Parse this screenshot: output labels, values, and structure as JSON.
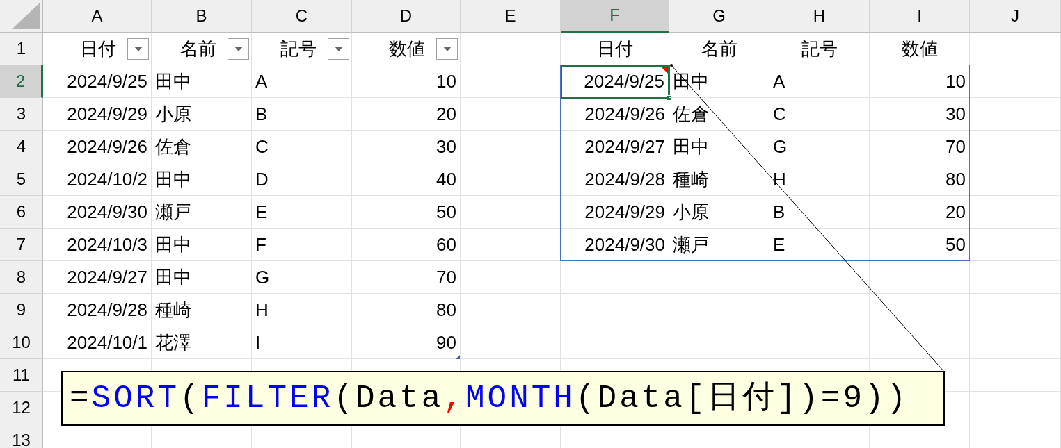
{
  "column_headers": [
    {
      "label": "A",
      "selected": false
    },
    {
      "label": "B",
      "selected": false
    },
    {
      "label": "C",
      "selected": false
    },
    {
      "label": "D",
      "selected": false
    },
    {
      "label": "E",
      "selected": false
    },
    {
      "label": "F",
      "selected": true
    },
    {
      "label": "G",
      "selected": false
    },
    {
      "label": "H",
      "selected": false
    },
    {
      "label": "I",
      "selected": false
    },
    {
      "label": "J",
      "selected": false
    }
  ],
  "row_headers": [
    {
      "label": "1",
      "selected": false
    },
    {
      "label": "2",
      "selected": true
    },
    {
      "label": "3",
      "selected": false
    },
    {
      "label": "4",
      "selected": false
    },
    {
      "label": "5",
      "selected": false
    },
    {
      "label": "6",
      "selected": false
    },
    {
      "label": "7",
      "selected": false
    },
    {
      "label": "8",
      "selected": false
    },
    {
      "label": "9",
      "selected": false
    },
    {
      "label": "10",
      "selected": false
    },
    {
      "label": "11",
      "selected": false
    },
    {
      "label": "12",
      "selected": false
    },
    {
      "label": "13",
      "selected": false
    }
  ],
  "source_table": {
    "columns": [
      {
        "label": "日付",
        "filter": true
      },
      {
        "label": "名前",
        "filter": true
      },
      {
        "label": "記号",
        "filter": true
      },
      {
        "label": "数値",
        "filter": true
      }
    ],
    "rows": [
      [
        "2024/9/25",
        "田中",
        "A",
        "10"
      ],
      [
        "2024/9/29",
        "小原",
        "B",
        "20"
      ],
      [
        "2024/9/26",
        "佐倉",
        "C",
        "30"
      ],
      [
        "2024/10/2",
        "田中",
        "D",
        "40"
      ],
      [
        "2024/9/30",
        "瀬戸",
        "E",
        "50"
      ],
      [
        "2024/10/3",
        "田中",
        "F",
        "60"
      ],
      [
        "2024/9/27",
        "田中",
        "G",
        "70"
      ],
      [
        "2024/9/28",
        "種崎",
        "H",
        "80"
      ],
      [
        "2024/10/1",
        "花澤",
        "I",
        "90"
      ]
    ]
  },
  "result_table": {
    "columns": [
      {
        "label": "日付"
      },
      {
        "label": "名前"
      },
      {
        "label": "記号"
      },
      {
        "label": "数値"
      }
    ],
    "rows": [
      [
        "2024/9/25",
        "田中",
        "A",
        "10"
      ],
      [
        "2024/9/26",
        "佐倉",
        "C",
        "30"
      ],
      [
        "2024/9/27",
        "田中",
        "G",
        "70"
      ],
      [
        "2024/9/28",
        "種崎",
        "H",
        "80"
      ],
      [
        "2024/9/29",
        "小原",
        "B",
        "20"
      ],
      [
        "2024/9/30",
        "瀬戸",
        "E",
        "50"
      ]
    ]
  },
  "formula_callout": {
    "segments": [
      {
        "text": "=",
        "kind": "plain"
      },
      {
        "text": "SORT",
        "kind": "function"
      },
      {
        "text": "(",
        "kind": "plain"
      },
      {
        "text": "FILTER",
        "kind": "function"
      },
      {
        "text": "(Data",
        "kind": "plain"
      },
      {
        "text": ",",
        "kind": "separator"
      },
      {
        "text": "MONTH",
        "kind": "function"
      },
      {
        "text": "(Data[日付])=9))",
        "kind": "plain"
      }
    ]
  }
}
